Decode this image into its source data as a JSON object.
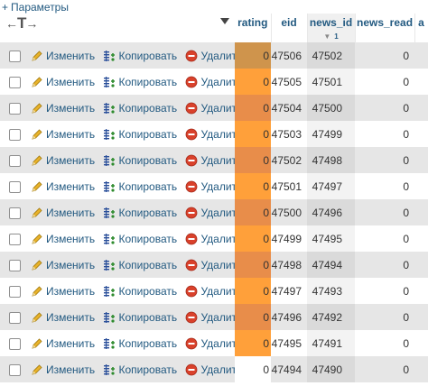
{
  "options_link": "Параметры",
  "header": {
    "rating": "rating",
    "eid": "eid",
    "news_id": "news_id",
    "news_id_sort_arrow": "▼",
    "news_id_sort_order": "1",
    "news_read": "news_read",
    "cut": "a"
  },
  "actions": {
    "edit": "Изменить",
    "copy": "Копировать",
    "delete": "Удалить"
  },
  "rows": [
    {
      "rating": "0",
      "eid": "47506",
      "news_id": "47502",
      "news_read": "0"
    },
    {
      "rating": "0",
      "eid": "47505",
      "news_id": "47501",
      "news_read": "0"
    },
    {
      "rating": "0",
      "eid": "47504",
      "news_id": "47500",
      "news_read": "0"
    },
    {
      "rating": "0",
      "eid": "47503",
      "news_id": "47499",
      "news_read": "0"
    },
    {
      "rating": "0",
      "eid": "47502",
      "news_id": "47498",
      "news_read": "0"
    },
    {
      "rating": "0",
      "eid": "47501",
      "news_id": "47497",
      "news_read": "0"
    },
    {
      "rating": "0",
      "eid": "47500",
      "news_id": "47496",
      "news_read": "0"
    },
    {
      "rating": "0",
      "eid": "47499",
      "news_id": "47495",
      "news_read": "0"
    },
    {
      "rating": "0",
      "eid": "47498",
      "news_id": "47494",
      "news_read": "0"
    },
    {
      "rating": "0",
      "eid": "47497",
      "news_id": "47493",
      "news_read": "0"
    },
    {
      "rating": "0",
      "eid": "47496",
      "news_id": "47492",
      "news_read": "0"
    },
    {
      "rating": "0",
      "eid": "47495",
      "news_id": "47491",
      "news_read": "0"
    },
    {
      "rating": "0",
      "eid": "47494",
      "news_id": "47490",
      "news_read": "0"
    }
  ],
  "colors": {
    "link": "#235a81",
    "row_odd": "#e6e6e6",
    "rating_highlight": "#ffa03a",
    "delete_icon": "#d9412b",
    "edit_icon": "#e8b22a"
  },
  "icons": {
    "edit": "pencil-icon",
    "copy": "copy-icon",
    "delete": "delete-icon",
    "menu": "dropdown-triangle-icon",
    "columns": "column-arrows-icon"
  }
}
